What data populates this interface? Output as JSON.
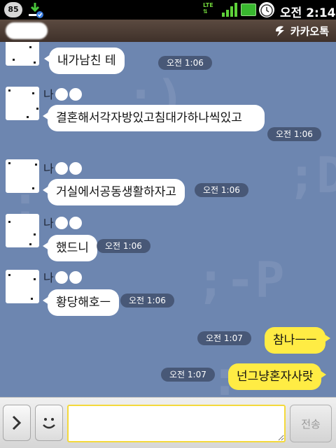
{
  "status_bar": {
    "badge": "85",
    "network": "LTE",
    "time": "오전 2:14"
  },
  "title_bar": {
    "brand": "카카오톡",
    "brand_icon": "kakaotalk-logo-icon"
  },
  "messages": [
    {
      "type": "in",
      "text": "내가남친 테",
      "time": "오전 1:06"
    },
    {
      "type": "in",
      "sender": "나",
      "text": "결혼해서각자방있고침대가하나씩있고",
      "time": "오전 1:06"
    },
    {
      "type": "in",
      "sender": "나",
      "text": "거실에서공동생활하자고",
      "time": "오전 1:06"
    },
    {
      "type": "in",
      "sender": "나",
      "text": "했드니",
      "time": "오전 1:06"
    },
    {
      "type": "in",
      "sender": "나",
      "text": "황당해호ㅡ",
      "time": "오전 1:06"
    },
    {
      "type": "out",
      "text": "참나ㅡㅡ",
      "time": "오전 1:07"
    },
    {
      "type": "out",
      "text": "넌그냥혼자사랏",
      "time": "오전 1:07"
    }
  ],
  "input_bar": {
    "expand_icon": "chevron-right-icon",
    "emoticon_icon": "smiley-icon",
    "message_value": "",
    "send_label": "전송"
  },
  "colors": {
    "chat_background": "#6d86b0",
    "outgoing_bubble": "#ffec44",
    "incoming_bubble": "#ffffff",
    "title_bar": "#4a3b33"
  }
}
